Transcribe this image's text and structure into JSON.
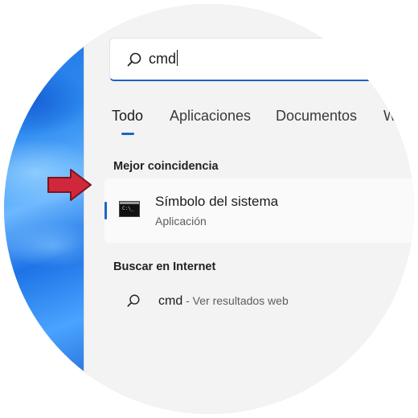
{
  "search": {
    "query": "cmd"
  },
  "tabs": [
    {
      "label": "Todo",
      "active": true
    },
    {
      "label": "Aplicaciones",
      "active": false
    },
    {
      "label": "Documentos",
      "active": false
    },
    {
      "label": "W",
      "active": false
    }
  ],
  "best_match": {
    "section_label": "Mejor coincidencia",
    "title": "Símbolo del sistema",
    "subtitle": "Aplicación",
    "icon": "command-prompt-icon"
  },
  "web": {
    "section_label": "Buscar en Internet",
    "query": "cmd",
    "suffix": " - Ver resultados web",
    "icon": "search-icon"
  },
  "colors": {
    "accent": "#1a66c9",
    "arrow": "#d0283a",
    "panel": "#f3f3f3"
  }
}
